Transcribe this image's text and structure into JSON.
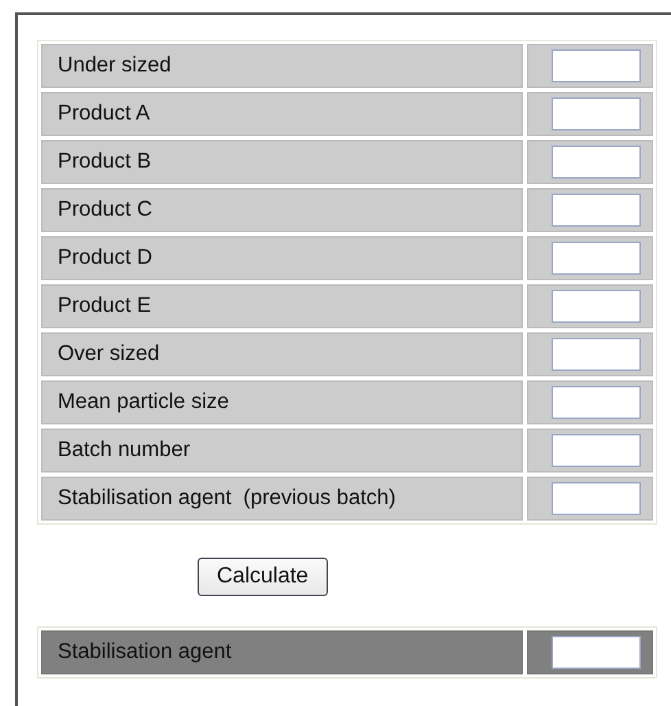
{
  "inputs": [
    {
      "label": "Under sized"
    },
    {
      "label": "Product A"
    },
    {
      "label": "Product B"
    },
    {
      "label": "Product C"
    },
    {
      "label": "Product D"
    },
    {
      "label": "Product E"
    },
    {
      "label": "Over sized"
    },
    {
      "label": "Mean particle size"
    },
    {
      "label": "Batch number"
    },
    {
      "label": "Stabilisation agent  (previous batch)"
    }
  ],
  "button": "Calculate",
  "result": {
    "label": "Stabilisation agent"
  }
}
